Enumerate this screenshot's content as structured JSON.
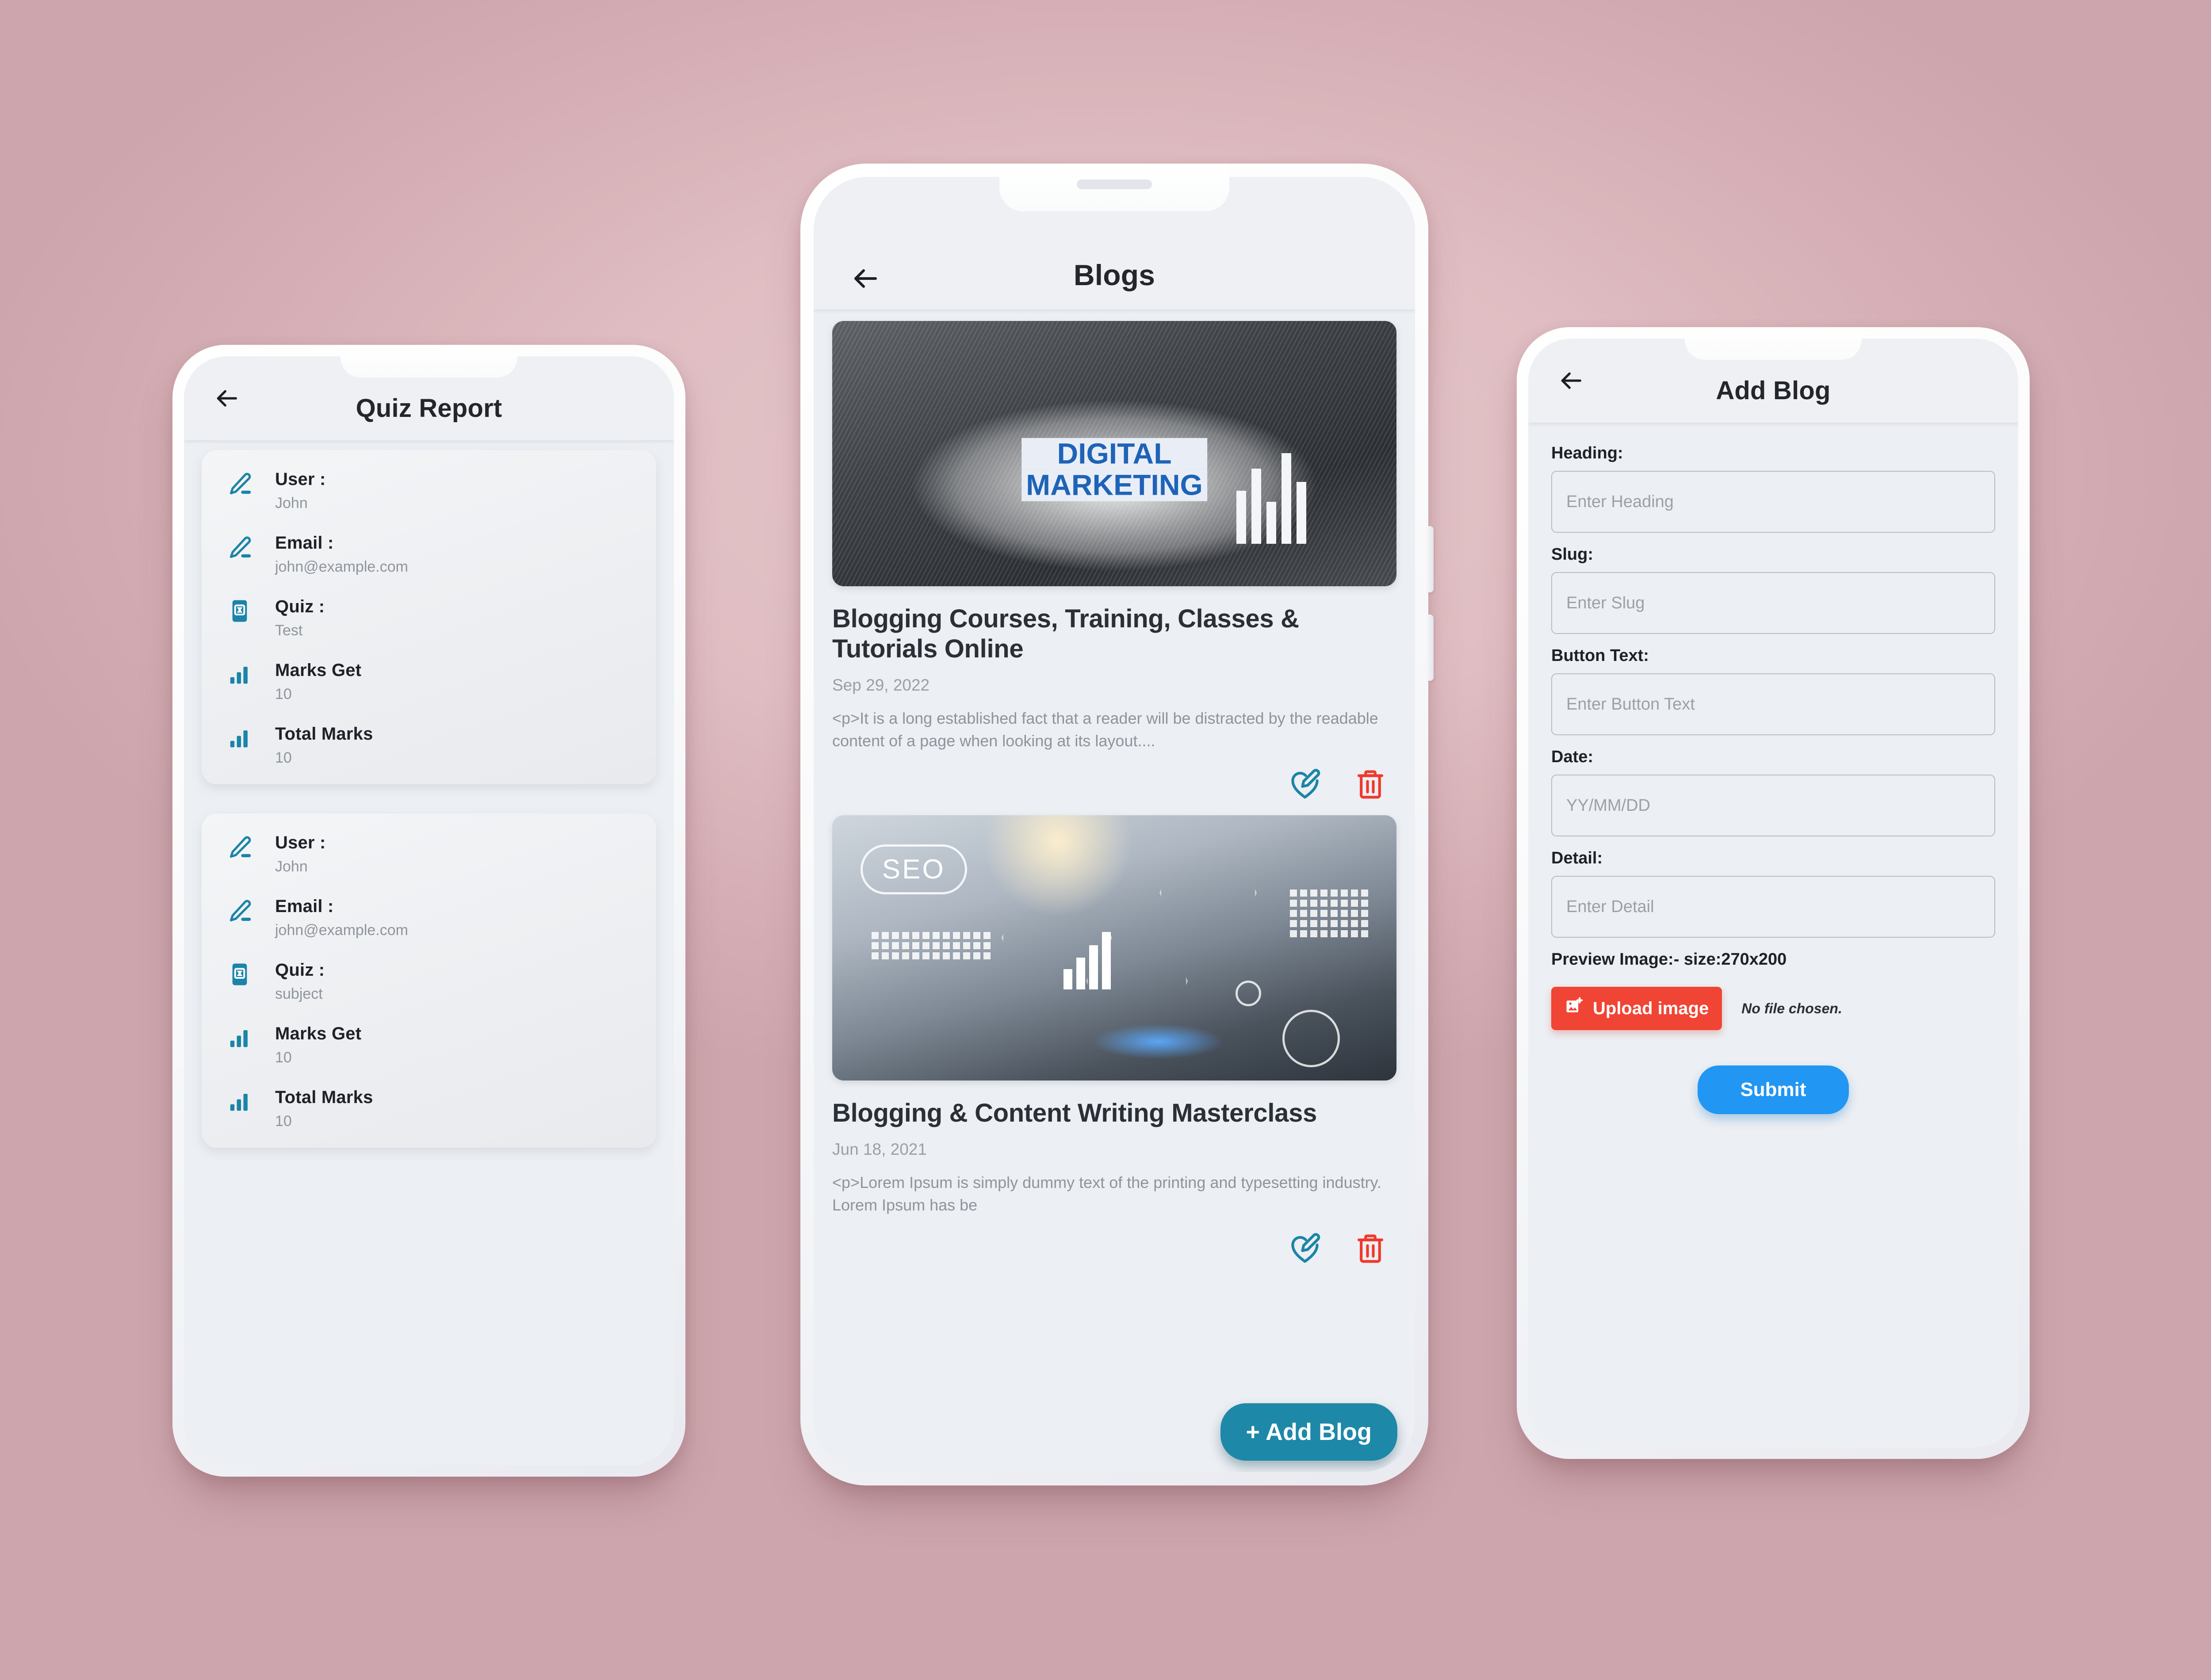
{
  "background_color": "#dfbdc2",
  "accent_teal": "#1e88a8",
  "accent_red": "#f04434",
  "accent_blue": "#2196f3",
  "phone1": {
    "title": "Quiz Report",
    "back_icon": "arrow-left-icon",
    "cards": [
      {
        "rows": [
          {
            "icon": "pencil-icon",
            "label": "User :",
            "value": "John"
          },
          {
            "icon": "pencil-icon",
            "label": "Email :",
            "value": "john@example.com"
          },
          {
            "icon": "quiz-book-icon",
            "label": "Quiz :",
            "value": "Test"
          },
          {
            "icon": "bar-chart-icon",
            "label": "Marks Get",
            "value": "10"
          },
          {
            "icon": "bar-chart-icon",
            "label": "Total Marks",
            "value": "10"
          }
        ]
      },
      {
        "rows": [
          {
            "icon": "pencil-icon",
            "label": "User :",
            "value": "John"
          },
          {
            "icon": "pencil-icon",
            "label": "Email :",
            "value": "john@example.com"
          },
          {
            "icon": "quiz-book-icon",
            "label": "Quiz :",
            "value": "subject"
          },
          {
            "icon": "bar-chart-icon",
            "label": "Marks Get",
            "value": "10"
          },
          {
            "icon": "bar-chart-icon",
            "label": "Total Marks",
            "value": "10"
          }
        ]
      }
    ]
  },
  "phone2": {
    "title": "Blogs",
    "back_icon": "arrow-left-icon",
    "fab_label": "+ Add Blog",
    "posts": [
      {
        "image_alt": "DIGITAL MARKETING",
        "image_word1": "DIGITAL",
        "image_word2": "MARKETING",
        "title": "Blogging Courses, Training, Classes & Tutorials Online",
        "date": "Sep 29, 2022",
        "excerpt": "<p>It is a long established fact that a reader will be distracted by the readable content of a page when looking at its layout....",
        "edit_icon": "edit-pencil-icon",
        "delete_icon": "trash-icon"
      },
      {
        "image_alt": "SEO",
        "image_word1": "SEO",
        "image_word2": "",
        "title": "Blogging & Content Writing Masterclass",
        "date": "Jun 18, 2021",
        "excerpt": "<p>Lorem Ipsum is simply dummy text of the printing and typesetting industry. Lorem Ipsum has be",
        "edit_icon": "edit-pencil-icon",
        "delete_icon": "trash-icon"
      }
    ]
  },
  "phone3": {
    "title": "Add Blog",
    "back_icon": "arrow-left-icon",
    "fields": [
      {
        "label": "Heading:",
        "placeholder": "Enter Heading"
      },
      {
        "label": "Slug:",
        "placeholder": "Enter Slug"
      },
      {
        "label": "Button Text:",
        "placeholder": "Enter Button Text"
      },
      {
        "label": "Date:",
        "placeholder": "YY/MM/DD"
      },
      {
        "label": "Detail:",
        "placeholder": "Enter Detail"
      }
    ],
    "preview_label": "Preview Image:- size:270x200",
    "upload_button": "Upload image",
    "upload_icon": "image-plus-icon",
    "no_file_text": "No file chosen.",
    "submit_button": "Submit"
  }
}
